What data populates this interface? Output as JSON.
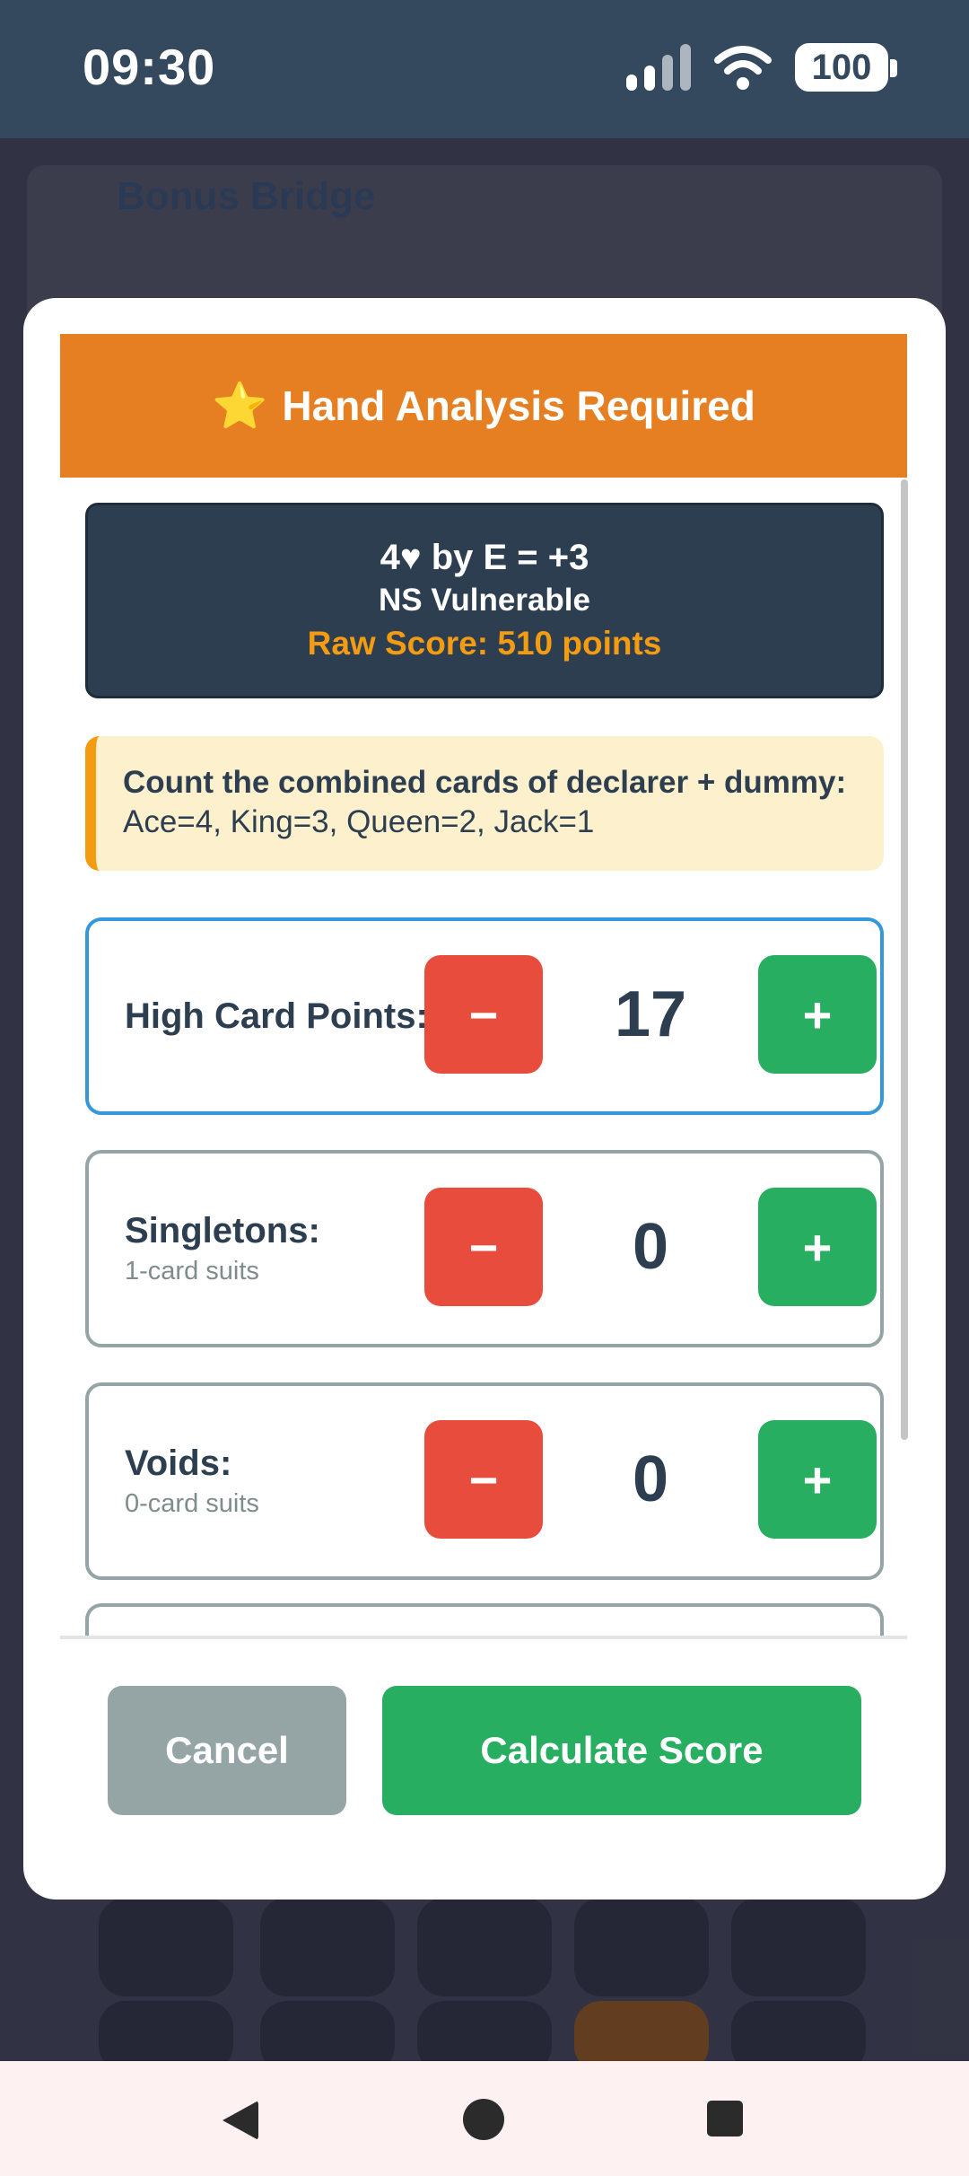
{
  "status_bar": {
    "time": "09:30",
    "battery": "100",
    "icons": [
      "signal-icon",
      "wifi-icon",
      "battery-icon"
    ]
  },
  "background_app": {
    "logo_text": "Bonus Bridge"
  },
  "modal": {
    "header": {
      "star": "⭐",
      "title": "Hand Analysis Required"
    },
    "contract": {
      "line": "4♥ by E = +3",
      "vulnerability": "NS Vulnerable",
      "raw_score": "Raw Score: 510 points"
    },
    "info": {
      "title": "Count the combined cards of declarer + dummy:",
      "text": "Ace=4, King=3, Queen=2, Jack=1"
    },
    "counters": [
      {
        "name": "High Card Points:",
        "sub": "",
        "value": "17",
        "minus": "−",
        "plus": "+"
      },
      {
        "name": "Singletons:",
        "sub": "1-card suits",
        "value": "0",
        "minus": "−",
        "plus": "+"
      },
      {
        "name": "Voids:",
        "sub": "0-card suits",
        "value": "0",
        "minus": "−",
        "plus": "+"
      }
    ],
    "footer": {
      "cancel_label": "Cancel",
      "calculate_label": "Calculate Score"
    }
  },
  "colors": {
    "header_orange": "#e67e22",
    "contract_dark": "#2c3e50",
    "score_orange": "#f39c12",
    "minus_red": "#e74c3c",
    "plus_green": "#27ae60",
    "cancel_gray": "#95a5a6",
    "active_border_blue": "#3498db"
  }
}
